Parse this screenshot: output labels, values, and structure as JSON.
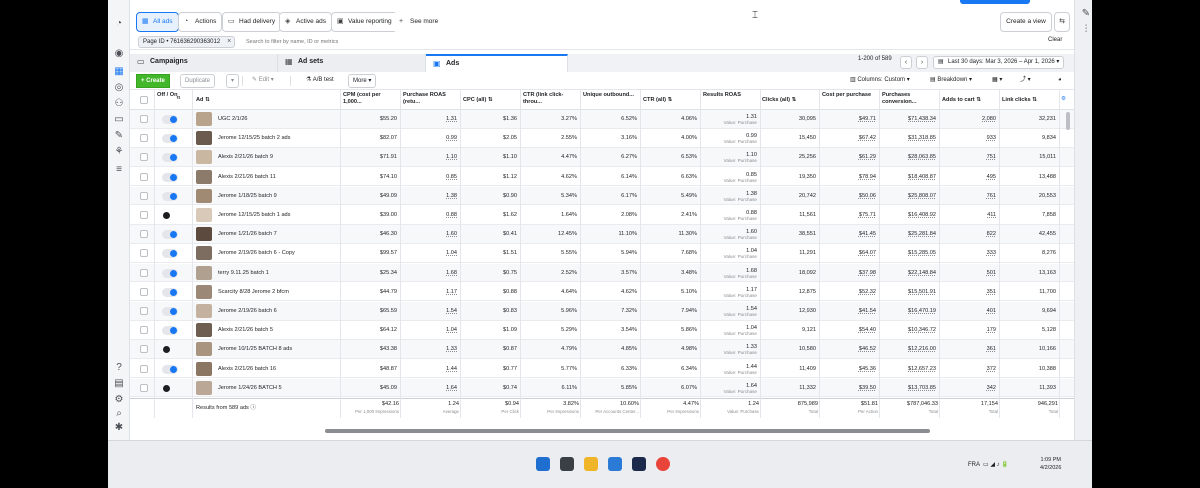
{
  "filters": {
    "all_ads": "All ads",
    "actions": "Actions",
    "had_delivery": "Had delivery",
    "active_ads": "Active ads",
    "value_reporting": "Value reporting",
    "see_more": "See more"
  },
  "create_view": "Create a view",
  "search": {
    "page_id_chip": "Page ID • 761636290363012",
    "placeholder": "Search to filter by name, ID or metrics",
    "clear": "Clear"
  },
  "tabs": {
    "campaigns": "Campaigns",
    "ad_sets": "Ad sets",
    "ads": "Ads"
  },
  "pager": "1-200 of 589",
  "date_range": "Last 30 days: Mar 3, 2026 – Apr 1, 2026",
  "toolbar": {
    "create": "+ Create",
    "duplicate": "Duplicate",
    "edit": "Edit",
    "ab_test": "A/B test",
    "more": "More",
    "columns": "Columns: Custom",
    "breakdown": "Breakdown"
  },
  "columns": {
    "off_on": "Off / On",
    "ad": "Ad",
    "cpm": "CPM (cost per 1,000...",
    "purchase_roas": "Purchase ROAS (retu...",
    "cpc": "CPC (all)",
    "ctr_link": "CTR (link click-throu...",
    "unique_outbound": "Unique outbound...",
    "ctr_all": "CTR (all)",
    "results_roas": "Results ROAS",
    "clicks_all": "Clicks (all)",
    "cost_per_purchase": "Cost per purchase",
    "purchases_conversion": "Purchases conversion...",
    "adds_to_cart": "Adds to cart",
    "link_clicks": "Link clicks"
  },
  "value_purchase": "Value: Purchase",
  "rows": [
    {
      "name": "UGC 2/1/26",
      "on": true,
      "cpm": "$55.20",
      "roas": "1.31",
      "cpc": "$1.36",
      "ctr_link": "3.27%",
      "uo": "6.52%",
      "ctr_all": "4.06%",
      "rroas": "1.31",
      "clicks": "30,095",
      "cpp": "$49.71",
      "pcv": "$71,438.34",
      "atc": "2,080",
      "lc": "32,231"
    },
    {
      "name": "Jerome 12/15/25 batch 2 ads",
      "on": true,
      "cpm": "$82.07",
      "roas": "0.99",
      "cpc": "$2.05",
      "ctr_link": "2.55%",
      "uo": "3.16%",
      "ctr_all": "4.00%",
      "rroas": "0.99",
      "clicks": "15,450",
      "cpp": "$67.42",
      "pcv": "$31,318.85",
      "atc": "933",
      "lc": "9,834"
    },
    {
      "name": "Alexis 2/21/26 batch 9",
      "on": true,
      "cpm": "$71.91",
      "roas": "1.10",
      "cpc": "$1.10",
      "ctr_link": "4.47%",
      "uo": "6.27%",
      "ctr_all": "6.53%",
      "rroas": "1.10",
      "clicks": "25,256",
      "cpp": "$61.29",
      "pcv": "$28,063.85",
      "atc": "751",
      "lc": "15,011"
    },
    {
      "name": "Alexis 2/21/26 batch 11",
      "on": true,
      "cpm": "$74.10",
      "roas": "0.85",
      "cpc": "$1.12",
      "ctr_link": "4.62%",
      "uo": "6.14%",
      "ctr_all": "6.63%",
      "rroas": "0.85",
      "clicks": "19,350",
      "cpp": "$78.94",
      "pcv": "$18,408.87",
      "atc": "495",
      "lc": "13,488"
    },
    {
      "name": "Jerome 1/18/25 batch 9",
      "on": true,
      "cpm": "$49.09",
      "roas": "1.38",
      "cpc": "$0.90",
      "ctr_link": "5.34%",
      "uo": "6.17%",
      "ctr_all": "5.49%",
      "rroas": "1.38",
      "clicks": "20,742",
      "cpp": "$50.06",
      "pcv": "$25,808.07",
      "atc": "761",
      "lc": "20,553"
    },
    {
      "name": "Jerome 12/15/25 batch 1 ads",
      "on": false,
      "cpm": "$39.00",
      "roas": "0.88",
      "cpc": "$1.62",
      "ctr_link": "1.64%",
      "uo": "2.08%",
      "ctr_all": "2.41%",
      "rroas": "0.88",
      "clicks": "11,561",
      "cpp": "$75.71",
      "pcv": "$16,408.92",
      "atc": "411",
      "lc": "7,858"
    },
    {
      "name": "Jerome 1/21/26 batch 7",
      "on": true,
      "cpm": "$46.30",
      "roas": "1.60",
      "cpc": "$0.41",
      "ctr_link": "12.45%",
      "uo": "11.10%",
      "ctr_all": "11.30%",
      "rroas": "1.60",
      "clicks": "38,551",
      "cpp": "$41.45",
      "pcv": "$25,281.84",
      "atc": "822",
      "lc": "42,455"
    },
    {
      "name": "Jerome 2/19/26 batch 6 - Copy",
      "on": true,
      "cpm": "$99.57",
      "roas": "1.04",
      "cpc": "$1.51",
      "ctr_link": "5.55%",
      "uo": "5.94%",
      "ctr_all": "7.68%",
      "rroas": "1.04",
      "clicks": "11,291",
      "cpp": "$64.07",
      "pcv": "$15,285.05",
      "atc": "333",
      "lc": "8,276"
    },
    {
      "name": "terry 9.11.25 batch 1",
      "on": true,
      "cpm": "$25.34",
      "roas": "1.68",
      "cpc": "$0.75",
      "ctr_link": "2.52%",
      "uo": "3.57%",
      "ctr_all": "3.48%",
      "rroas": "1.68",
      "clicks": "18,092",
      "cpp": "$37.98",
      "pcv": "$22,148.84",
      "atc": "501",
      "lc": "13,163"
    },
    {
      "name": "Scarcity 8/28 Jerome 2 bfcm",
      "on": true,
      "cpm": "$44.79",
      "roas": "1.17",
      "cpc": "$0.88",
      "ctr_link": "4.64%",
      "uo": "4.62%",
      "ctr_all": "5.10%",
      "rroas": "1.17",
      "clicks": "12,875",
      "cpp": "$52.32",
      "pcv": "$15,501.91",
      "atc": "351",
      "lc": "11,700"
    },
    {
      "name": "Jerome 2/19/26 batch 6",
      "on": true,
      "cpm": "$65.59",
      "roas": "1.54",
      "cpc": "$0.83",
      "ctr_link": "5.96%",
      "uo": "7.32%",
      "ctr_all": "7.94%",
      "rroas": "1.54",
      "clicks": "12,930",
      "cpp": "$41.54",
      "pcv": "$16,470.19",
      "atc": "401",
      "lc": "9,694"
    },
    {
      "name": "Alexis 2/21/26 batch 5",
      "on": true,
      "cpm": "$64.12",
      "roas": "1.04",
      "cpc": "$1.09",
      "ctr_link": "5.29%",
      "uo": "3.54%",
      "ctr_all": "5.86%",
      "rroas": "1.04",
      "clicks": "9,121",
      "cpp": "$54.40",
      "pcv": "$10,346.72",
      "atc": "179",
      "lc": "5,128"
    },
    {
      "name": "Jerome 10/1/25 BATCH 8 ads",
      "on": false,
      "cpm": "$43.38",
      "roas": "1.33",
      "cpc": "$0.87",
      "ctr_link": "4.79%",
      "uo": "4.85%",
      "ctr_all": "4.98%",
      "rroas": "1.33",
      "clicks": "10,580",
      "cpp": "$46.52",
      "pcv": "$12,216.00",
      "atc": "361",
      "lc": "10,166"
    },
    {
      "name": "Alexis 2/21/26 batch 16",
      "on": true,
      "cpm": "$48.87",
      "roas": "1.44",
      "cpc": "$0.77",
      "ctr_link": "5.77%",
      "uo": "6.33%",
      "ctr_all": "6.34%",
      "rroas": "1.44",
      "clicks": "11,409",
      "cpp": "$45.36",
      "pcv": "$12,657.23",
      "atc": "372",
      "lc": "10,388"
    },
    {
      "name": "Jerome 1/24/26 BATCH 5",
      "on": false,
      "cpm": "$45.09",
      "roas": "1.64",
      "cpc": "$0.74",
      "ctr_link": "6.11%",
      "uo": "5.85%",
      "ctr_all": "6.07%",
      "rroas": "1.64",
      "clicks": "11,332",
      "cpp": "$39.50",
      "pcv": "$13,703.85",
      "atc": "342",
      "lc": "11,393"
    }
  ],
  "totals": {
    "label": "Results from 589 ads",
    "cpm": "$42.16",
    "cpm_sub": "Per 1,000 Impressions",
    "roas": "1.24",
    "roas_sub": "Average",
    "cpc": "$0.94",
    "cpc_sub": "Per Click",
    "ctr_link": "3.82%",
    "ctr_link_sub": "Per Impressions",
    "uo": "10.60%",
    "uo_sub": "Per Accounts Center...",
    "ctr_all": "4.47%",
    "ctr_all_sub": "Per Impressions",
    "rroas": "1.24",
    "rroas_sub": "Value: Purchase",
    "clicks": "875,989",
    "clicks_sub": "Total",
    "cpp": "$51.81",
    "cpp_sub": "Per Action",
    "pcv": "$787,046.33",
    "pcv_sub": "Total",
    "atc": "17,154",
    "atc_sub": "Total",
    "lc": "946,291",
    "lc_sub": "Total"
  },
  "tray": {
    "lang": "FRA",
    "time": "1:09 PM",
    "date": "4/2/2026"
  }
}
